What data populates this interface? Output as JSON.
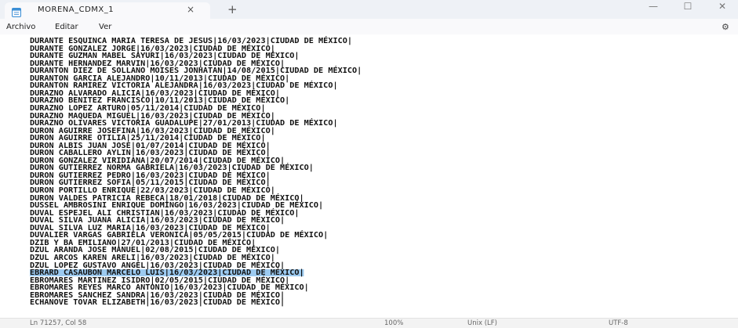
{
  "window": {
    "tab_title": "MORENA_CDMX_1",
    "tab_close": "×",
    "new_tab": "+",
    "minimize": "—",
    "maximize": "☐",
    "close": "✕"
  },
  "menu": {
    "items": [
      "Archivo",
      "Editar",
      "Ver"
    ],
    "settings_icon": "gear-icon"
  },
  "editor": {
    "lines": [
      "DURANTE ESQUINCA MARIA TERESA DE JESUS|16/03/2023|CIUDAD DE MÉXICO|",
      "DURANTE GONZALEZ JORGE|16/03/2023|CIUDAD DE MÉXICO|",
      "DURANTE GUZMAN MABEL SAYURI|16/03/2023|CIUDAD DE MÉXICO|",
      "DURANTE HERNANDEZ MARVIN|16/03/2023|CIUDAD DE MÉXICO|",
      "DURANTON DIEZ DE SOLLANO MOISES JONHATAN|14/08/2015|CIUDAD DE MÉXICO|",
      "DURANTON GARCIA ALEJANDRO|10/11/2013|CIUDAD DE MÉXICO|",
      "DURANTON RAMIREZ VICTORIA ALEJANDRA|16/03/2023|CIUDAD DE MÉXICO|",
      "DURAZNO ALVARADO ALICIA|16/03/2023|CIUDAD DE MÉXICO|",
      "DURAZNO BENITEZ FRANCISCO|10/11/2013|CIUDAD DE MÉXICO|",
      "DURAZNO LOPEZ ARTURO|05/11/2014|CIUDAD DE MÉXICO|",
      "DURAZNO MAQUEDA MIGUEL|16/03/2023|CIUDAD DE MÉXICO|",
      "DURAZNO OLIVARES VICTORIA GUADALUPE|27/01/2013|CIUDAD DE MÉXICO|",
      "DURON AGUIRRE JOSEFINA|16/03/2023|CIUDAD DE MÉXICO|",
      "DURON AGUIRRE OTILIA|25/11/2014|CIUDAD DE MÉXICO|",
      "DURON ALBIS JUAN JOSE|01/07/2014|CIUDAD DE MÉXICO|",
      "DURON CABALLERO AYLIN|16/03/2023|CIUDAD DE MÉXICO|",
      "DURON GONZALEZ VIRIDIANA|20/07/2014|CIUDAD DE MÉXICO|",
      "DURON GUTIERREZ NORMA GABRIELA|16/03/2023|CIUDAD DE MÉXICO|",
      "DURON GUTIERREZ PEDRO|16/03/2023|CIUDAD DE MÉXICO|",
      "DURON GUTIERREZ SOFIA|05/11/2015|CIUDAD DE MÉXICO|",
      "DURON PORTILLO ENRIQUE|22/03/2023|CIUDAD DE MÉXICO|",
      "DURON VALDES PATRICIA REBECA|18/01/2018|CIUDAD DE MÉXICO|",
      "DUSSEL AMBROSINI ENRIQUE DOMINGO|16/03/2023|CIUDAD DE MÉXICO|",
      "DUVAL ESPEJEL ALI CHRISTIAN|16/03/2023|CIUDAD DE MÉXICO|",
      "DUVAL SILVA JUANA ALICIA|16/03/2023|CIUDAD DE MÉXICO|",
      "DUVAL SILVA LUZ MARIA|16/03/2023|CIUDAD DE MÉXICO|",
      "DUVALIER VARGAS GABRIELA VERONICA|05/05/2015|CIUDAD DE MÉXICO|",
      "DZIB Y BA EMILIANO|27/01/2013|CIUDAD DE MÉXICO|",
      "DZUL ARANDA JOSE MANUEL|02/08/2015|CIUDAD DE MÉXICO|",
      "DZUL ARCOS KAREN ARELI|16/03/2023|CIUDAD DE MÉXICO|",
      "DZUL LOPEZ GUSTAVO ANGEL|16/03/2023|CIUDAD DE MÉXICO|",
      "EBRARD CASAUBON MARCELO LUIS|16/03/2023|CIUDAD DE MÉXICO|",
      "EBROMARES MARTINEZ ISIDRO|02/05/2015|CIUDAD DE MÉXICO|",
      "EBROMARES REYES MARCO ANTONIO|16/03/2023|CIUDAD DE MÉXICO|",
      "EBROMARES SANCHEZ SANDRA|16/03/2023|CIUDAD DE MÉXICO|",
      "ECHANOVE TOVAR ELIZABETH|16/03/2023|CIUDAD DE MÉXICO|"
    ],
    "selected_line": 31
  },
  "status": {
    "position": "Ln 71257, Col 58",
    "zoom": "100%",
    "line_ending": "Unix (LF)",
    "encoding": "UTF-8"
  }
}
